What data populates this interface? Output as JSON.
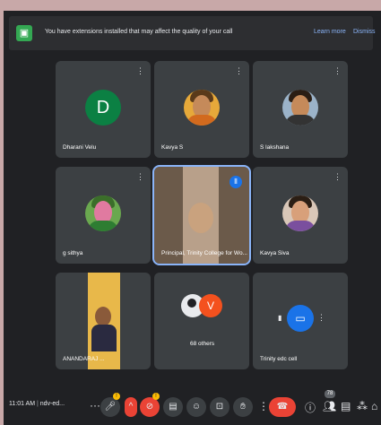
{
  "banner": {
    "icon": "extension-icon",
    "message": "You have extensions installed that may affect the quality of your call",
    "learn_more": "Learn more",
    "dismiss": "Dismiss"
  },
  "participants": [
    {
      "name": "Dharani Velu",
      "avatar_letter": "D"
    },
    {
      "name": "Kavya S"
    },
    {
      "name": "S lakshana"
    },
    {
      "name": "g sithya"
    },
    {
      "name": "Principal, Trinity College for Wo..."
    },
    {
      "name": "Kavya Siva"
    },
    {
      "name": "ANANDARAJ ..."
    },
    {
      "name": "68 others",
      "avatar_letter": "V"
    },
    {
      "name": "Trinity edc cell"
    }
  ],
  "toolbar": {
    "time": "11:01 AM",
    "meeting_code": "ndv-ed..."
  },
  "badges": {
    "participant_count": "78",
    "mic_badge": "!",
    "camera_badge": "!"
  },
  "colors": {
    "accent": "#8ab4f8",
    "danger": "#ea4335",
    "letter_avatar": "#0b8043",
    "v_avatar": "#f4511e"
  }
}
